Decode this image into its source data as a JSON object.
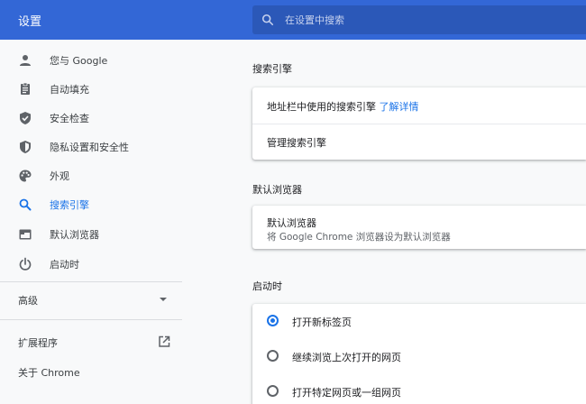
{
  "header": {
    "title": "设置",
    "search_placeholder": "在设置中搜索"
  },
  "sidebar": {
    "items": [
      {
        "label": "您与 Google",
        "icon": "person-icon"
      },
      {
        "label": "自动填充",
        "icon": "clipboard-icon"
      },
      {
        "label": "安全检查",
        "icon": "shield-check-icon"
      },
      {
        "label": "隐私设置和安全性",
        "icon": "shield-icon"
      },
      {
        "label": "外观",
        "icon": "palette-icon"
      },
      {
        "label": "搜索引擎",
        "icon": "search-icon",
        "active": true
      },
      {
        "label": "默认浏览器",
        "icon": "browser-icon"
      },
      {
        "label": "启动时",
        "icon": "power-icon"
      }
    ],
    "advanced_label": "高级",
    "extensions_label": "扩展程序",
    "about_label": "关于 Chrome"
  },
  "main": {
    "search_engine": {
      "title": "搜索引擎",
      "address_bar_label": "地址栏中使用的搜索引擎",
      "learn_more": "了解详情",
      "manage_label": "管理搜索引擎"
    },
    "default_browser": {
      "title": "默认浏览器",
      "card_title": "默认浏览器",
      "card_subtitle": "将 Google Chrome 浏览器设为默认浏览器"
    },
    "startup": {
      "title": "启动时",
      "options": [
        {
          "label": "打开新标签页",
          "checked": true
        },
        {
          "label": "继续浏览上次打开的网页",
          "checked": false
        },
        {
          "label": "打开特定网页或一组网页",
          "checked": false
        }
      ]
    }
  },
  "colors": {
    "header_bg": "#3367d6",
    "accent": "#1a73e8",
    "page_bg": "#f8f9fa"
  }
}
